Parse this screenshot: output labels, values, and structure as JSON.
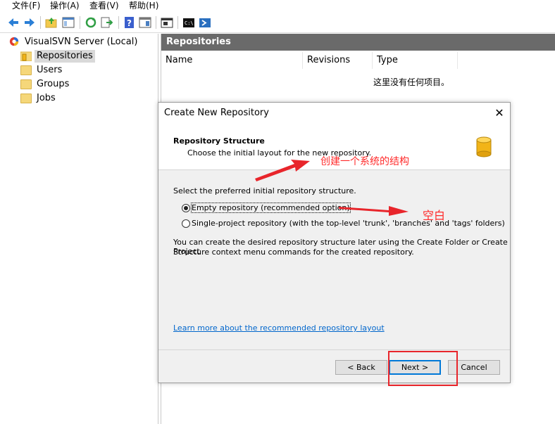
{
  "menu": [
    "文件(F)",
    "操作(A)",
    "查看(V)",
    "帮助(H)"
  ],
  "toolbar_icons": [
    "back-icon",
    "forward-icon",
    "up-folder-icon",
    "show-hide-tree-icon",
    "refresh-icon",
    "export-list-icon",
    "help-icon",
    "properties-icon",
    "console-icon",
    "terminal-icon",
    "powershell-icon"
  ],
  "tree": {
    "root": "VisualSVN Server (Local)",
    "items": [
      "Repositories",
      "Users",
      "Groups",
      "Jobs"
    ]
  },
  "right_pane": {
    "title": "Repositories",
    "columns": [
      "Name",
      "Revisions",
      "Type"
    ],
    "empty_text": "这里没有任何项目。"
  },
  "dialog": {
    "title": "Create New Repository",
    "close": "✕",
    "heading": "Repository Structure",
    "subheading": "Choose the initial layout for the new repository.",
    "prompt": "Select the preferred initial repository structure.",
    "options": [
      {
        "label": "Empty repository (recommended option)",
        "selected": true
      },
      {
        "label": "Single-project repository (with the top-level 'trunk', 'branches' and 'tags' folders)",
        "selected": false
      }
    ],
    "info_line1": "You can create the desired repository structure later using the Create Folder or Create Project",
    "info_line2": "Structure context menu commands for the created repository.",
    "link": "Learn more about the recommended repository layout",
    "buttons": {
      "back": "< Back",
      "next": "Next >",
      "cancel": "Cancel"
    }
  },
  "annotations": {
    "arrow1_text": "创建一个系统的结构",
    "arrow2_text": "空白",
    "color": "#e8252b"
  }
}
